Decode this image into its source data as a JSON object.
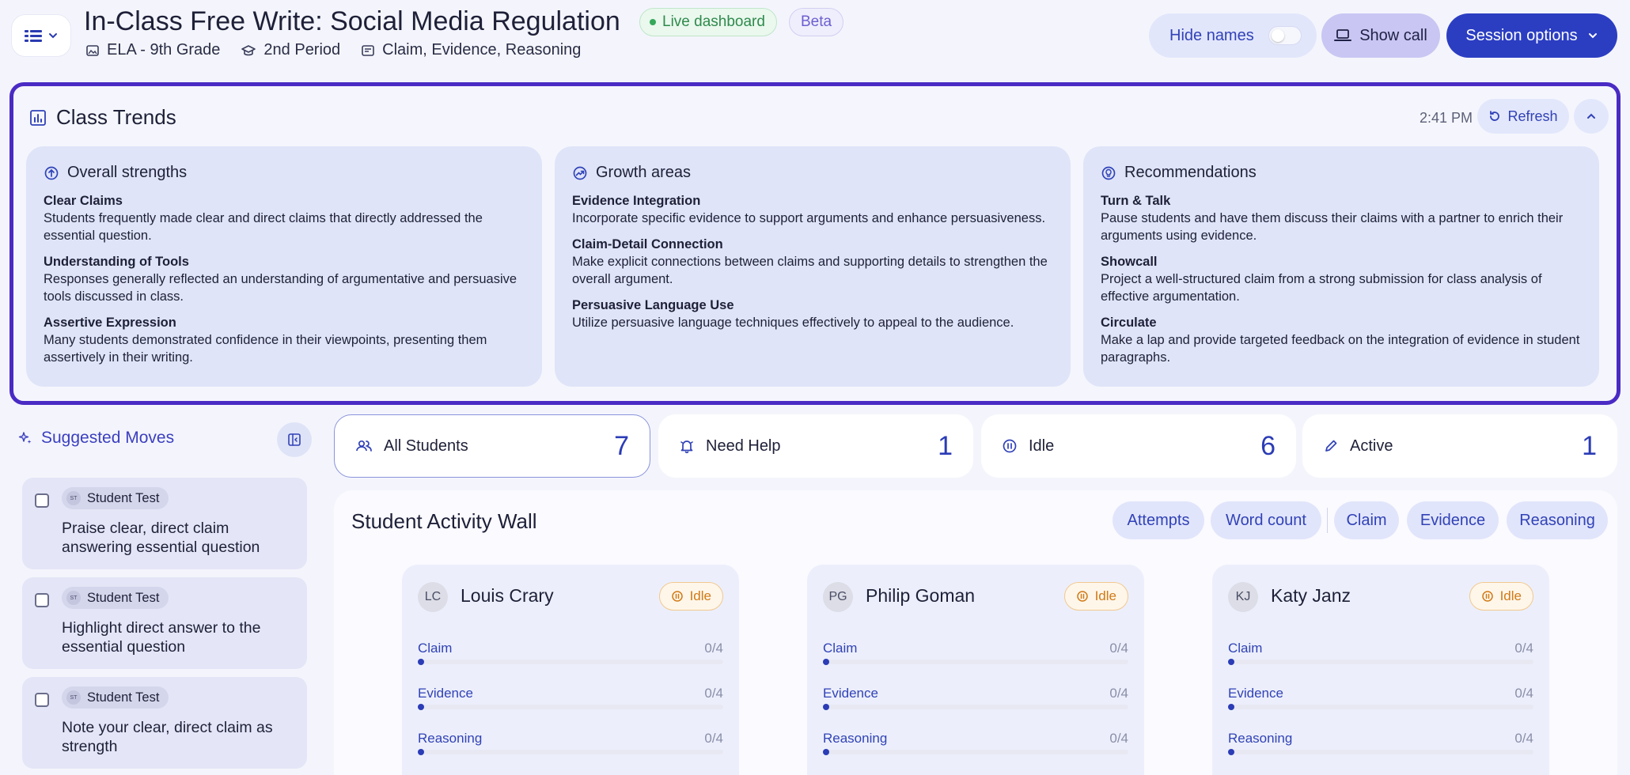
{
  "header": {
    "title": "In-Class Free Write: Social Media Regulation",
    "badges": {
      "live": "Live dashboard",
      "beta": "Beta"
    },
    "meta": {
      "subject": "ELA - 9th Grade",
      "period": "2nd Period",
      "framework": "Claim, Evidence, Reasoning"
    },
    "hide_names_label": "Hide names",
    "hide_names_on": false,
    "show_call_label": "Show call",
    "session_options_label": "Session options"
  },
  "trends": {
    "title": "Class Trends",
    "timestamp": "2:41 PM",
    "refresh_label": "Refresh",
    "cards": [
      {
        "title": "Overall strengths",
        "items": [
          {
            "title": "Clear Claims",
            "text": "Students frequently made clear and direct claims that directly addressed the essential question."
          },
          {
            "title": "Understanding of Tools",
            "text": "Responses generally reflected an understanding of argumentative and persuasive tools discussed in class."
          },
          {
            "title": "Assertive Expression",
            "text": "Many students demonstrated confidence in their viewpoints, presenting them assertively in their writing."
          }
        ]
      },
      {
        "title": "Growth areas",
        "items": [
          {
            "title": "Evidence Integration",
            "text": "Incorporate specific evidence to support arguments and enhance persuasiveness."
          },
          {
            "title": "Claim-Detail Connection",
            "text": "Make explicit connections between claims and supporting details to strengthen the overall argument."
          },
          {
            "title": "Persuasive Language Use",
            "text": "Utilize persuasive language techniques effectively to appeal to the audience."
          }
        ]
      },
      {
        "title": "Recommendations",
        "items": [
          {
            "title": "Turn & Talk",
            "text": "Pause students and have them discuss their claims with a partner to enrich their arguments using evidence."
          },
          {
            "title": "Showcall",
            "text": "Project a well-structured claim from a strong submission for class analysis of effective argumentation."
          },
          {
            "title": "Circulate",
            "text": "Make a lap and provide targeted feedback on the integration of evidence in student paragraphs."
          }
        ]
      }
    ]
  },
  "moves": {
    "title": "Suggested Moves",
    "items": [
      {
        "tag_initials": "ST",
        "tag": "Student Test",
        "text": "Praise clear, direct claim answering essential question"
      },
      {
        "tag_initials": "ST",
        "tag": "Student Test",
        "text": "Highlight direct answer to the essential question"
      },
      {
        "tag_initials": "ST",
        "tag": "Student Test",
        "text": "Note your clear, direct claim as strength"
      }
    ]
  },
  "filters": [
    {
      "label": "All Students",
      "count": "7",
      "icon": "users-icon"
    },
    {
      "label": "Need Help",
      "count": "1",
      "icon": "bell-icon"
    },
    {
      "label": "Idle",
      "count": "6",
      "icon": "pause-icon"
    },
    {
      "label": "Active",
      "count": "1",
      "icon": "pencil-icon"
    }
  ],
  "wall": {
    "title": "Student Activity Wall",
    "pills": [
      "Attempts",
      "Word count",
      "Claim",
      "Evidence",
      "Reasoning"
    ],
    "students": [
      {
        "initials": "LC",
        "name": "Louis Crary",
        "status": "Idle",
        "metrics": [
          {
            "label": "Claim",
            "score": "0/4",
            "value": 0
          },
          {
            "label": "Evidence",
            "score": "0/4",
            "value": 0
          },
          {
            "label": "Reasoning",
            "score": "0/4",
            "value": 0
          }
        ]
      },
      {
        "initials": "PG",
        "name": "Philip Goman",
        "status": "Idle",
        "metrics": [
          {
            "label": "Claim",
            "score": "0/4",
            "value": 0
          },
          {
            "label": "Evidence",
            "score": "0/4",
            "value": 0
          },
          {
            "label": "Reasoning",
            "score": "0/4",
            "value": 0
          }
        ]
      },
      {
        "initials": "KJ",
        "name": "Katy Janz",
        "status": "Idle",
        "metrics": [
          {
            "label": "Claim",
            "score": "0/4",
            "value": 0
          },
          {
            "label": "Evidence",
            "score": "0/4",
            "value": 0
          },
          {
            "label": "Reasoning",
            "score": "0/4",
            "value": 0
          }
        ]
      }
    ]
  },
  "colors": {
    "accent": "#2b3ec2",
    "highlight_border": "#4a2bc4",
    "live_green": "#35a85a",
    "idle_orange": "#d07a16"
  }
}
